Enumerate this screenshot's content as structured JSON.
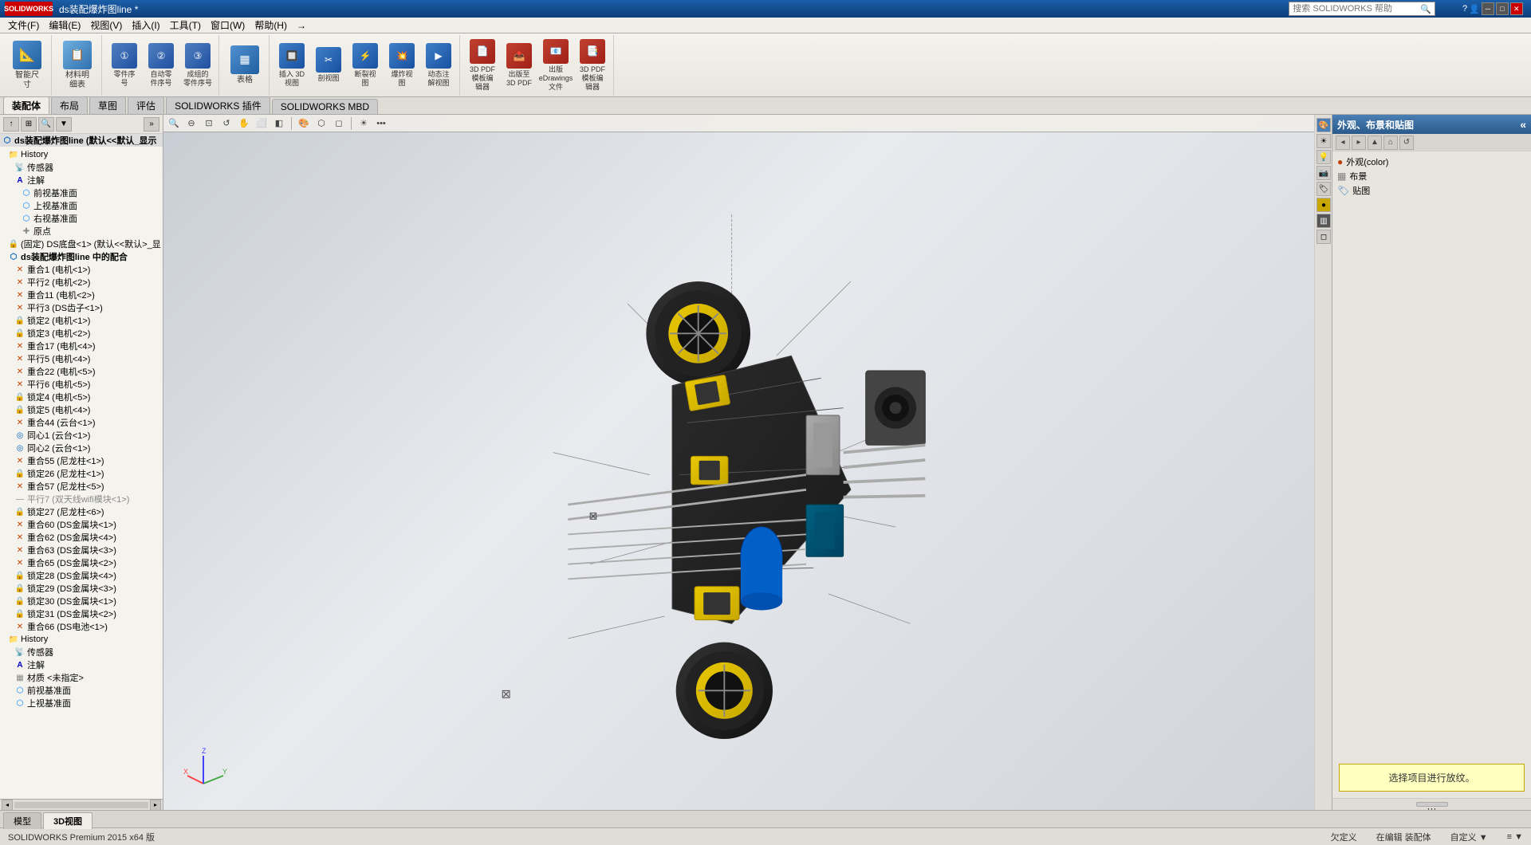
{
  "app": {
    "title": "ds装配爆炸图line *",
    "logo": "SOLIDWORKS",
    "version": "SOLIDWORKS Premium 2015 x64 版"
  },
  "titlebar": {
    "title": "ds装配爆炸图line *",
    "search_placeholder": "搜索 SOLIDWORKS 帮助",
    "help_label": "帮助(H)"
  },
  "menubar": {
    "items": [
      "文件(F)",
      "编辑(E)",
      "视图(V)",
      "插入(I)",
      "工具(T)",
      "窗口(W)",
      "帮助(H)",
      "→"
    ]
  },
  "toolbar": {
    "groups": [
      {
        "buttons": [
          {
            "label": "智能尺\n寸",
            "icon": "📐"
          },
          {
            "label": "材料明\n细表",
            "icon": "📋"
          }
        ]
      },
      {
        "buttons": [
          {
            "label": "零件序\n号",
            "icon": "①"
          },
          {
            "label": "自动零\n件序号",
            "icon": "②"
          },
          {
            "label": "成组的\n零件序号",
            "icon": "③"
          }
        ]
      },
      {
        "buttons": [
          {
            "label": "表格",
            "icon": "▦"
          }
        ]
      },
      {
        "buttons": [
          {
            "label": "插入 3D\n视图",
            "icon": "🔲"
          },
          {
            "label": "剖视图",
            "icon": "✂"
          },
          {
            "label": "断裂视\n图",
            "icon": "⚡"
          },
          {
            "label": "爆炸视\n图",
            "icon": "💥"
          },
          {
            "label": "动态注\n解视图",
            "icon": "▶"
          }
        ]
      },
      {
        "buttons": [
          {
            "label": "3D PDF\n模板编\n辑器",
            "icon": "📄"
          },
          {
            "label": "出版至\n3D PDF",
            "icon": "📤"
          },
          {
            "label": "出版\neDrawings\n文件",
            "icon": "📧"
          },
          {
            "label": "3D PDF\n模板编\n辑器",
            "icon": "📑"
          }
        ]
      }
    ]
  },
  "tabs": [
    "装配体",
    "布局",
    "草图",
    "评估",
    "SOLIDWORKS 插件",
    "SOLIDWORKS MBD"
  ],
  "left_panel": {
    "title": "ds装配爆炸图line (默认<<默认_显示状态>)",
    "tree_items": [
      {
        "indent": 0,
        "icon": "folder",
        "label": "History",
        "type": "history"
      },
      {
        "indent": 1,
        "icon": "sensor",
        "label": "传感器"
      },
      {
        "indent": 1,
        "icon": "annotation",
        "label": "注解"
      },
      {
        "indent": 2,
        "icon": "plane",
        "label": "前视基准面"
      },
      {
        "indent": 2,
        "icon": "plane",
        "label": "上视基准面"
      },
      {
        "indent": 2,
        "icon": "plane",
        "label": "右视基准面"
      },
      {
        "indent": 2,
        "icon": "origin",
        "label": "原点"
      },
      {
        "indent": 1,
        "icon": "fixed",
        "label": "(固定) DS底盘<1> (默认<<默认>_显示"
      },
      {
        "indent": 1,
        "icon": "assembly",
        "label": "ds装配爆炸图line 中的配合"
      },
      {
        "indent": 2,
        "icon": "coincident",
        "label": "重合1 (电机<1>)"
      },
      {
        "indent": 2,
        "icon": "parallel",
        "label": "平行2 (电机<2>)"
      },
      {
        "indent": 2,
        "icon": "coincident",
        "label": "重合11 (电机<2>)"
      },
      {
        "indent": 2,
        "icon": "parallel",
        "label": "平行3 (DS齿子<1>)"
      },
      {
        "indent": 2,
        "icon": "coincident",
        "label": "重合17 (电机<4>)"
      },
      {
        "indent": 2,
        "icon": "parallel",
        "label": "平行5 (电机<4>)"
      },
      {
        "indent": 2,
        "icon": "lock",
        "label": "锁定3 (电机<2>)"
      },
      {
        "indent": 2,
        "icon": "lock",
        "label": "锁定2 (电机<1>)"
      },
      {
        "indent": 2,
        "icon": "coincident",
        "label": "重合22 (电机<5>)"
      },
      {
        "indent": 2,
        "icon": "parallel",
        "label": "平行6 (电机<5>)"
      },
      {
        "indent": 2,
        "icon": "lock",
        "label": "锁定4 (电机<5>)"
      },
      {
        "indent": 2,
        "icon": "lock",
        "label": "锁定5 (电机<4>)"
      },
      {
        "indent": 2,
        "icon": "coincident",
        "label": "重合44 (云台<1>)"
      },
      {
        "indent": 2,
        "icon": "concentric",
        "label": "同心1 (云台<1>)"
      },
      {
        "indent": 2,
        "icon": "concentric",
        "label": "同心2 (云台<1>)"
      },
      {
        "indent": 2,
        "icon": "coincident",
        "label": "重合55 (尼龙柱<1>)"
      },
      {
        "indent": 2,
        "icon": "lock",
        "label": "锁定26 (尼龙柱<1>)"
      },
      {
        "indent": 2,
        "icon": "coincident",
        "label": "重合57 (尼龙柱<5>)"
      },
      {
        "indent": 2,
        "icon": "parallel",
        "label": "平行7 (双天线wifi模块<1>)"
      },
      {
        "indent": 2,
        "icon": "lock",
        "label": "锁定27 (尼龙柱<6>)"
      },
      {
        "indent": 2,
        "icon": "coincident",
        "label": "重合60 (DS金属块<1>)"
      },
      {
        "indent": 2,
        "icon": "coincident",
        "label": "重合62 (DS金属块<4>)"
      },
      {
        "indent": 2,
        "icon": "coincident",
        "label": "重合63 (DS金属块<3>)"
      },
      {
        "indent": 2,
        "icon": "coincident",
        "label": "重合65 (DS金属块<2>)"
      },
      {
        "indent": 2,
        "icon": "lock",
        "label": "锁定28 (DS金属块<4>)"
      },
      {
        "indent": 2,
        "icon": "lock",
        "label": "锁定29 (DS金属块<3>)"
      },
      {
        "indent": 2,
        "icon": "lock",
        "label": "锁定30 (DS金属块<1>)"
      },
      {
        "indent": 2,
        "icon": "lock",
        "label": "锁定31 (DS金属块<2>)"
      },
      {
        "indent": 2,
        "icon": "coincident",
        "label": "重合66 (DS电池<1>)"
      },
      {
        "indent": 0,
        "icon": "folder",
        "label": "History",
        "type": "history2"
      },
      {
        "indent": 1,
        "icon": "sensor",
        "label": "传感器"
      },
      {
        "indent": 1,
        "icon": "annotation",
        "label": "注解"
      },
      {
        "indent": 1,
        "icon": "material",
        "label": "材质 <未指定>"
      },
      {
        "indent": 1,
        "icon": "plane",
        "label": "前视基准面"
      },
      {
        "indent": 1,
        "icon": "plane",
        "label": "上视基准面"
      }
    ]
  },
  "viewport": {
    "toolbar_icons": [
      "zoom-in",
      "zoom-out",
      "zoom-fit",
      "rotate",
      "pan",
      "select",
      "section",
      "appearance",
      "display-mode",
      "hide-show",
      "more"
    ],
    "coord_label": "⊠"
  },
  "right_panel": {
    "title": "外观、布景和贴图",
    "tabs": [
      "外观(color)",
      "布景",
      "贴图"
    ],
    "info_text": "选择项目进行放纹。",
    "icon_sidebar": [
      "appearance",
      "scenes",
      "lights",
      "camera",
      "decal",
      "color"
    ]
  },
  "bottom_tabs": [
    "模型",
    "3D视图"
  ],
  "statusbar": {
    "items": [
      "欠定义",
      "在编辑 装配体",
      "自定义 ▼",
      "≡ ▼"
    ]
  }
}
